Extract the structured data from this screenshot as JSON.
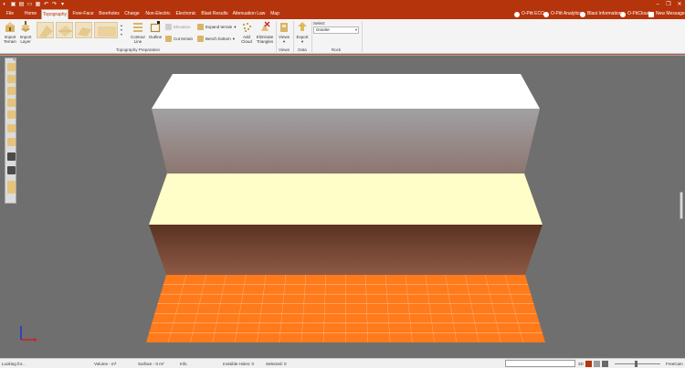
{
  "window": {
    "min_glyph": "–",
    "restore_glyph": "❐",
    "close_glyph": "✕"
  },
  "quick_access": {
    "app_glyph": "◐",
    "save_glyph": "▣",
    "open_glyph": "▤",
    "folder_glyph": "▭",
    "print_glyph": "▦",
    "undo_glyph": "↶",
    "redo_glyph": "↷",
    "more_glyph": "▾"
  },
  "tabs": [
    {
      "label": "File"
    },
    {
      "label": "Home"
    },
    {
      "label": "Topography"
    },
    {
      "label": "Free-Face"
    },
    {
      "label": "Boreholes"
    },
    {
      "label": "Charge"
    },
    {
      "label": "Non-Electric"
    },
    {
      "label": "Electronic"
    },
    {
      "label": "Blast Results"
    },
    {
      "label": "Attenuation Law"
    },
    {
      "label": "Map"
    }
  ],
  "right_links": {
    "eco": "O-Pitt ECO",
    "analytics": "O-Pitt Analytics",
    "blast_info": "Blast Information",
    "cloud": "O-PitCloud",
    "messages": "New Messages"
  },
  "ribbon": {
    "import_terrain": "Import\nTerrain",
    "import_layer": "Import\nLayer",
    "contour_line": "Contour\nLine",
    "outline": "Outline",
    "elevation": "Elevation",
    "cut_terrain": "Cut terrain",
    "expand_terrain": "Expand terrain",
    "bench_bottom": "Bench bottom",
    "add_cloud": "Add\nCloud",
    "eliminate_triangles": "Eliminate\nTriangles",
    "group_topography": "Topography Preparation",
    "views": "Views",
    "group_views": "Views",
    "export": "Export",
    "group_data": "Data",
    "select_label": "Select",
    "rock_value": "Granite",
    "group_rock": "Rock"
  },
  "scene": {
    "colors": {
      "top_bench": "#ffffff",
      "mid_bench": "#fffec8",
      "floor": "#ff7a1a",
      "floor_grid": "#ffd9b8"
    }
  },
  "statusbar": {
    "status": "Looking for...",
    "volume": "Volume - m³",
    "surface": "Surface - 0 m²",
    "info": "Info",
    "invisible_holes": "Invisible Holes: 0",
    "selected": "Selected: 0",
    "zoom_left": "2D",
    "pilot": "FreeCam"
  }
}
